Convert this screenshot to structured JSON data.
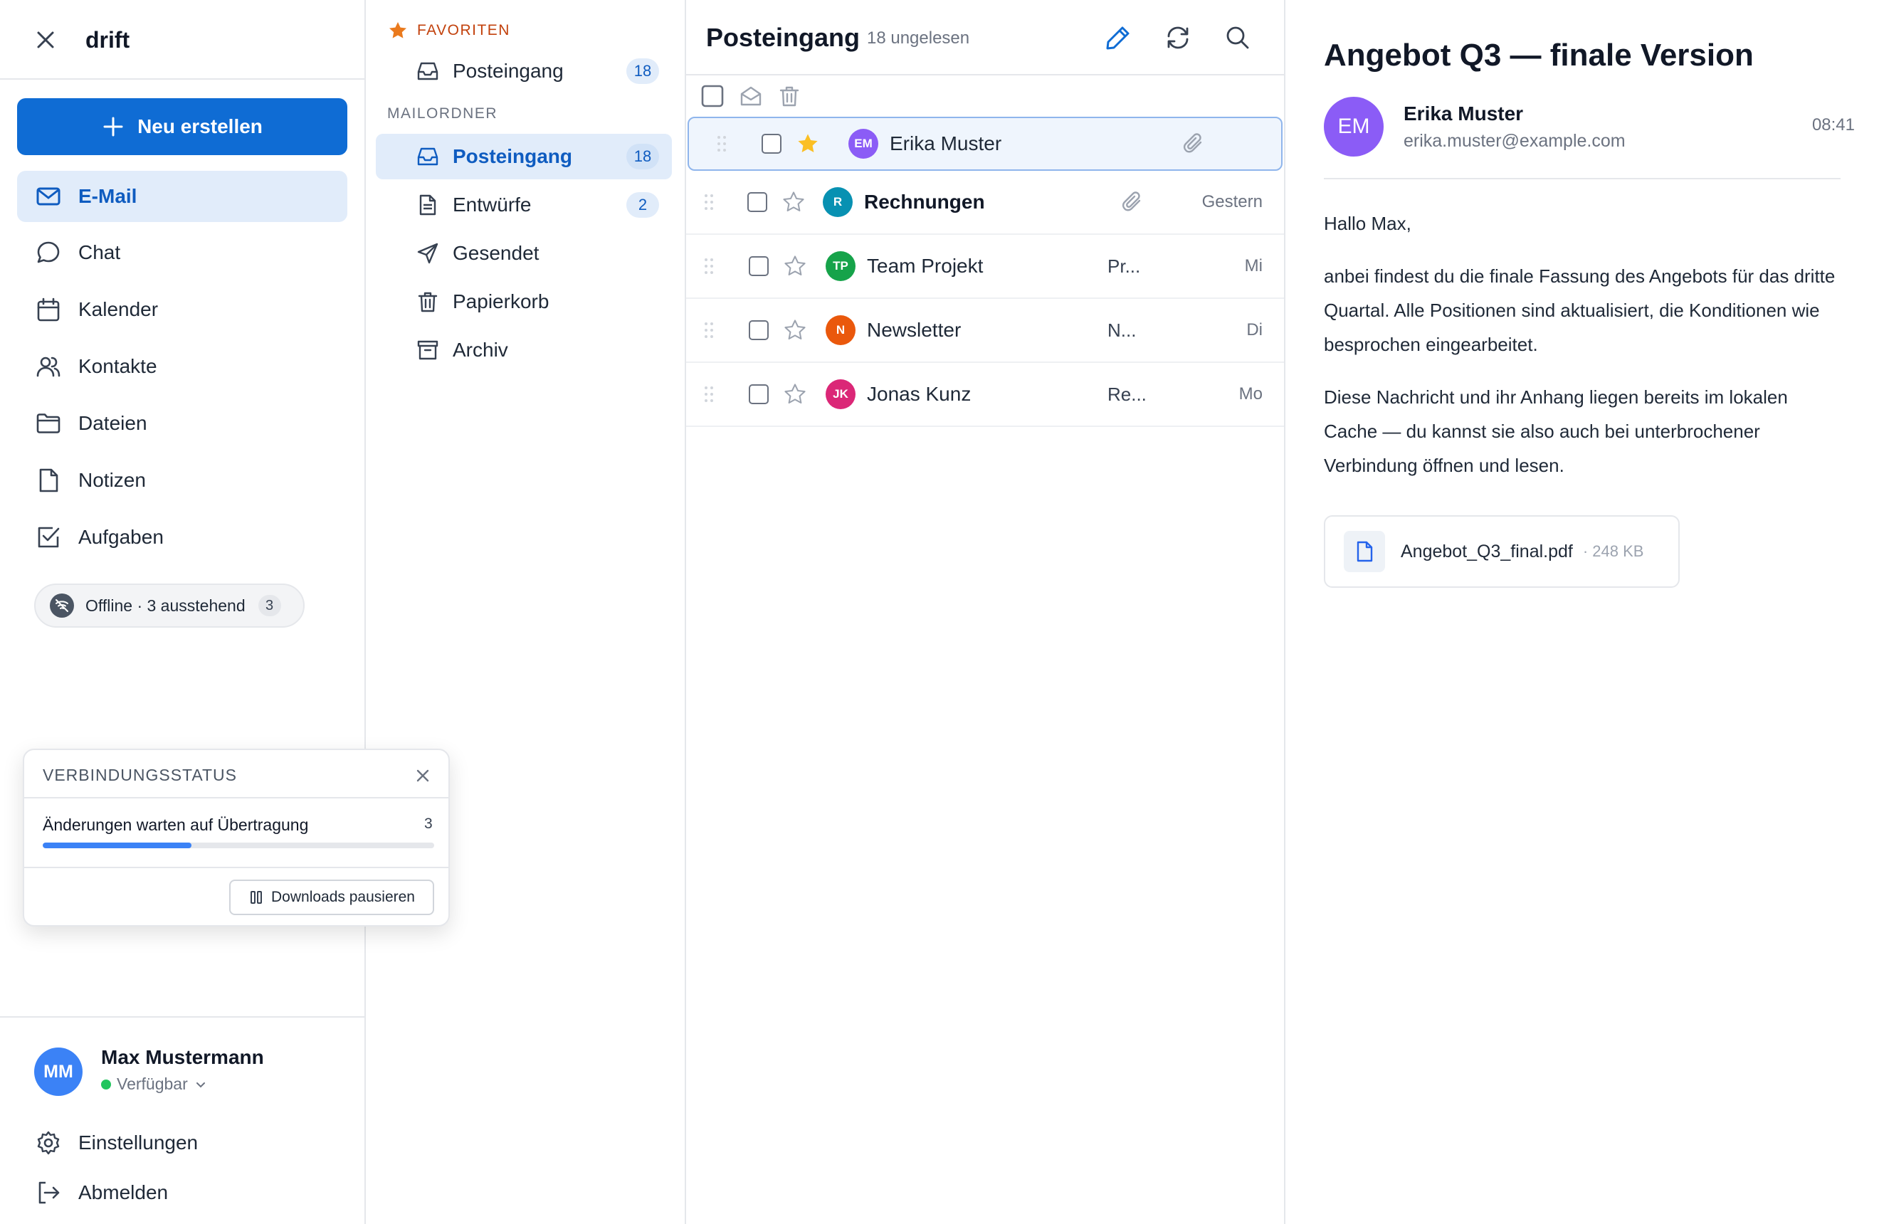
{
  "app": {
    "name": "drift"
  },
  "sidebar": {
    "new_label": "Neu erstellen",
    "items": [
      {
        "label": "E-Mail",
        "icon": "mail-icon"
      },
      {
        "label": "Chat",
        "icon": "chat-icon"
      },
      {
        "label": "Kalender",
        "icon": "calendar-icon"
      },
      {
        "label": "Kontakte",
        "icon": "contacts-icon"
      },
      {
        "label": "Dateien",
        "icon": "folder-icon"
      },
      {
        "label": "Notizen",
        "icon": "note-icon"
      },
      {
        "label": "Aufgaben",
        "icon": "checkbox-icon"
      }
    ],
    "offline": {
      "label": "Offline · 3 ausstehend",
      "count": "3"
    },
    "user": {
      "initials": "MM",
      "name": "Max Mustermann",
      "status": "Verfügbar",
      "status_color": "#22c55e"
    },
    "footer": {
      "settings": "Einstellungen",
      "logout": "Abmelden"
    }
  },
  "connection": {
    "title": "VERBINDUNGSSTATUS",
    "label": "Änderungen warten auf Übertragung",
    "count": "3",
    "progress": 0.38,
    "pause_label": "Downloads pausieren"
  },
  "folders": {
    "favorites_label": "FAVORITEN",
    "mailfolders_label": "MAILORDNER",
    "favorites": [
      {
        "label": "Posteingang",
        "count": "18"
      }
    ],
    "items": [
      {
        "label": "Posteingang",
        "count": "18",
        "icon": "inbox-icon"
      },
      {
        "label": "Entwürfe",
        "count": "2",
        "icon": "draft-icon"
      },
      {
        "label": "Gesendet",
        "count": "",
        "icon": "send-icon"
      },
      {
        "label": "Papierkorb",
        "count": "",
        "icon": "trash-icon"
      },
      {
        "label": "Archiv",
        "count": "",
        "icon": "archive-icon"
      }
    ]
  },
  "list": {
    "title": "Posteingang",
    "unread": "18 ungelesen",
    "rows": [
      {
        "initials": "EM",
        "sender": "Erika Muster",
        "snippet": "",
        "time": "",
        "starred": true,
        "attachment": true,
        "color": "#8b5cf6"
      },
      {
        "initials": "R",
        "sender": "Rechnungen",
        "snippet": "",
        "time": "Gestern",
        "starred": false,
        "attachment": true,
        "color": "#0891b2"
      },
      {
        "initials": "TP",
        "sender": "Team Projekt",
        "snippet": "Pr...",
        "time": "Mi",
        "starred": false,
        "attachment": false,
        "color": "#16a34a"
      },
      {
        "initials": "N",
        "sender": "Newsletter",
        "snippet": "N...",
        "time": "Di",
        "starred": false,
        "attachment": false,
        "color": "#ea580c"
      },
      {
        "initials": "JK",
        "sender": "Jonas Kunz",
        "snippet": "Re...",
        "time": "Mo",
        "starred": false,
        "attachment": false,
        "color": "#db2777"
      }
    ]
  },
  "reader": {
    "subject": "Angebot Q3 — finale Version",
    "from_initials": "EM",
    "from_name": "Erika Muster",
    "from_email": "erika.muster@example.com",
    "time": "08:41",
    "greeting": "Hallo Max,",
    "para1": "anbei findest du die finale Fassung des Angebots für das dritte Quartal. Alle Positionen sind aktualisiert, die Konditionen wie besprochen eingearbeitet.",
    "para2": "Diese Nachricht und ihr Anhang liegen bereits im lokalen Cache — du kannst sie also auch bei unterbrochener Verbindung öffnen und lesen.",
    "attachment_name": "Angebot_Q3_final.pdf",
    "attachment_size": "· 248 KB"
  },
  "colors": {
    "accent": "#0f6cd4",
    "selected_bg": "#e1ecfa",
    "favorite": "#c2410c",
    "star": "#fbbf24"
  }
}
